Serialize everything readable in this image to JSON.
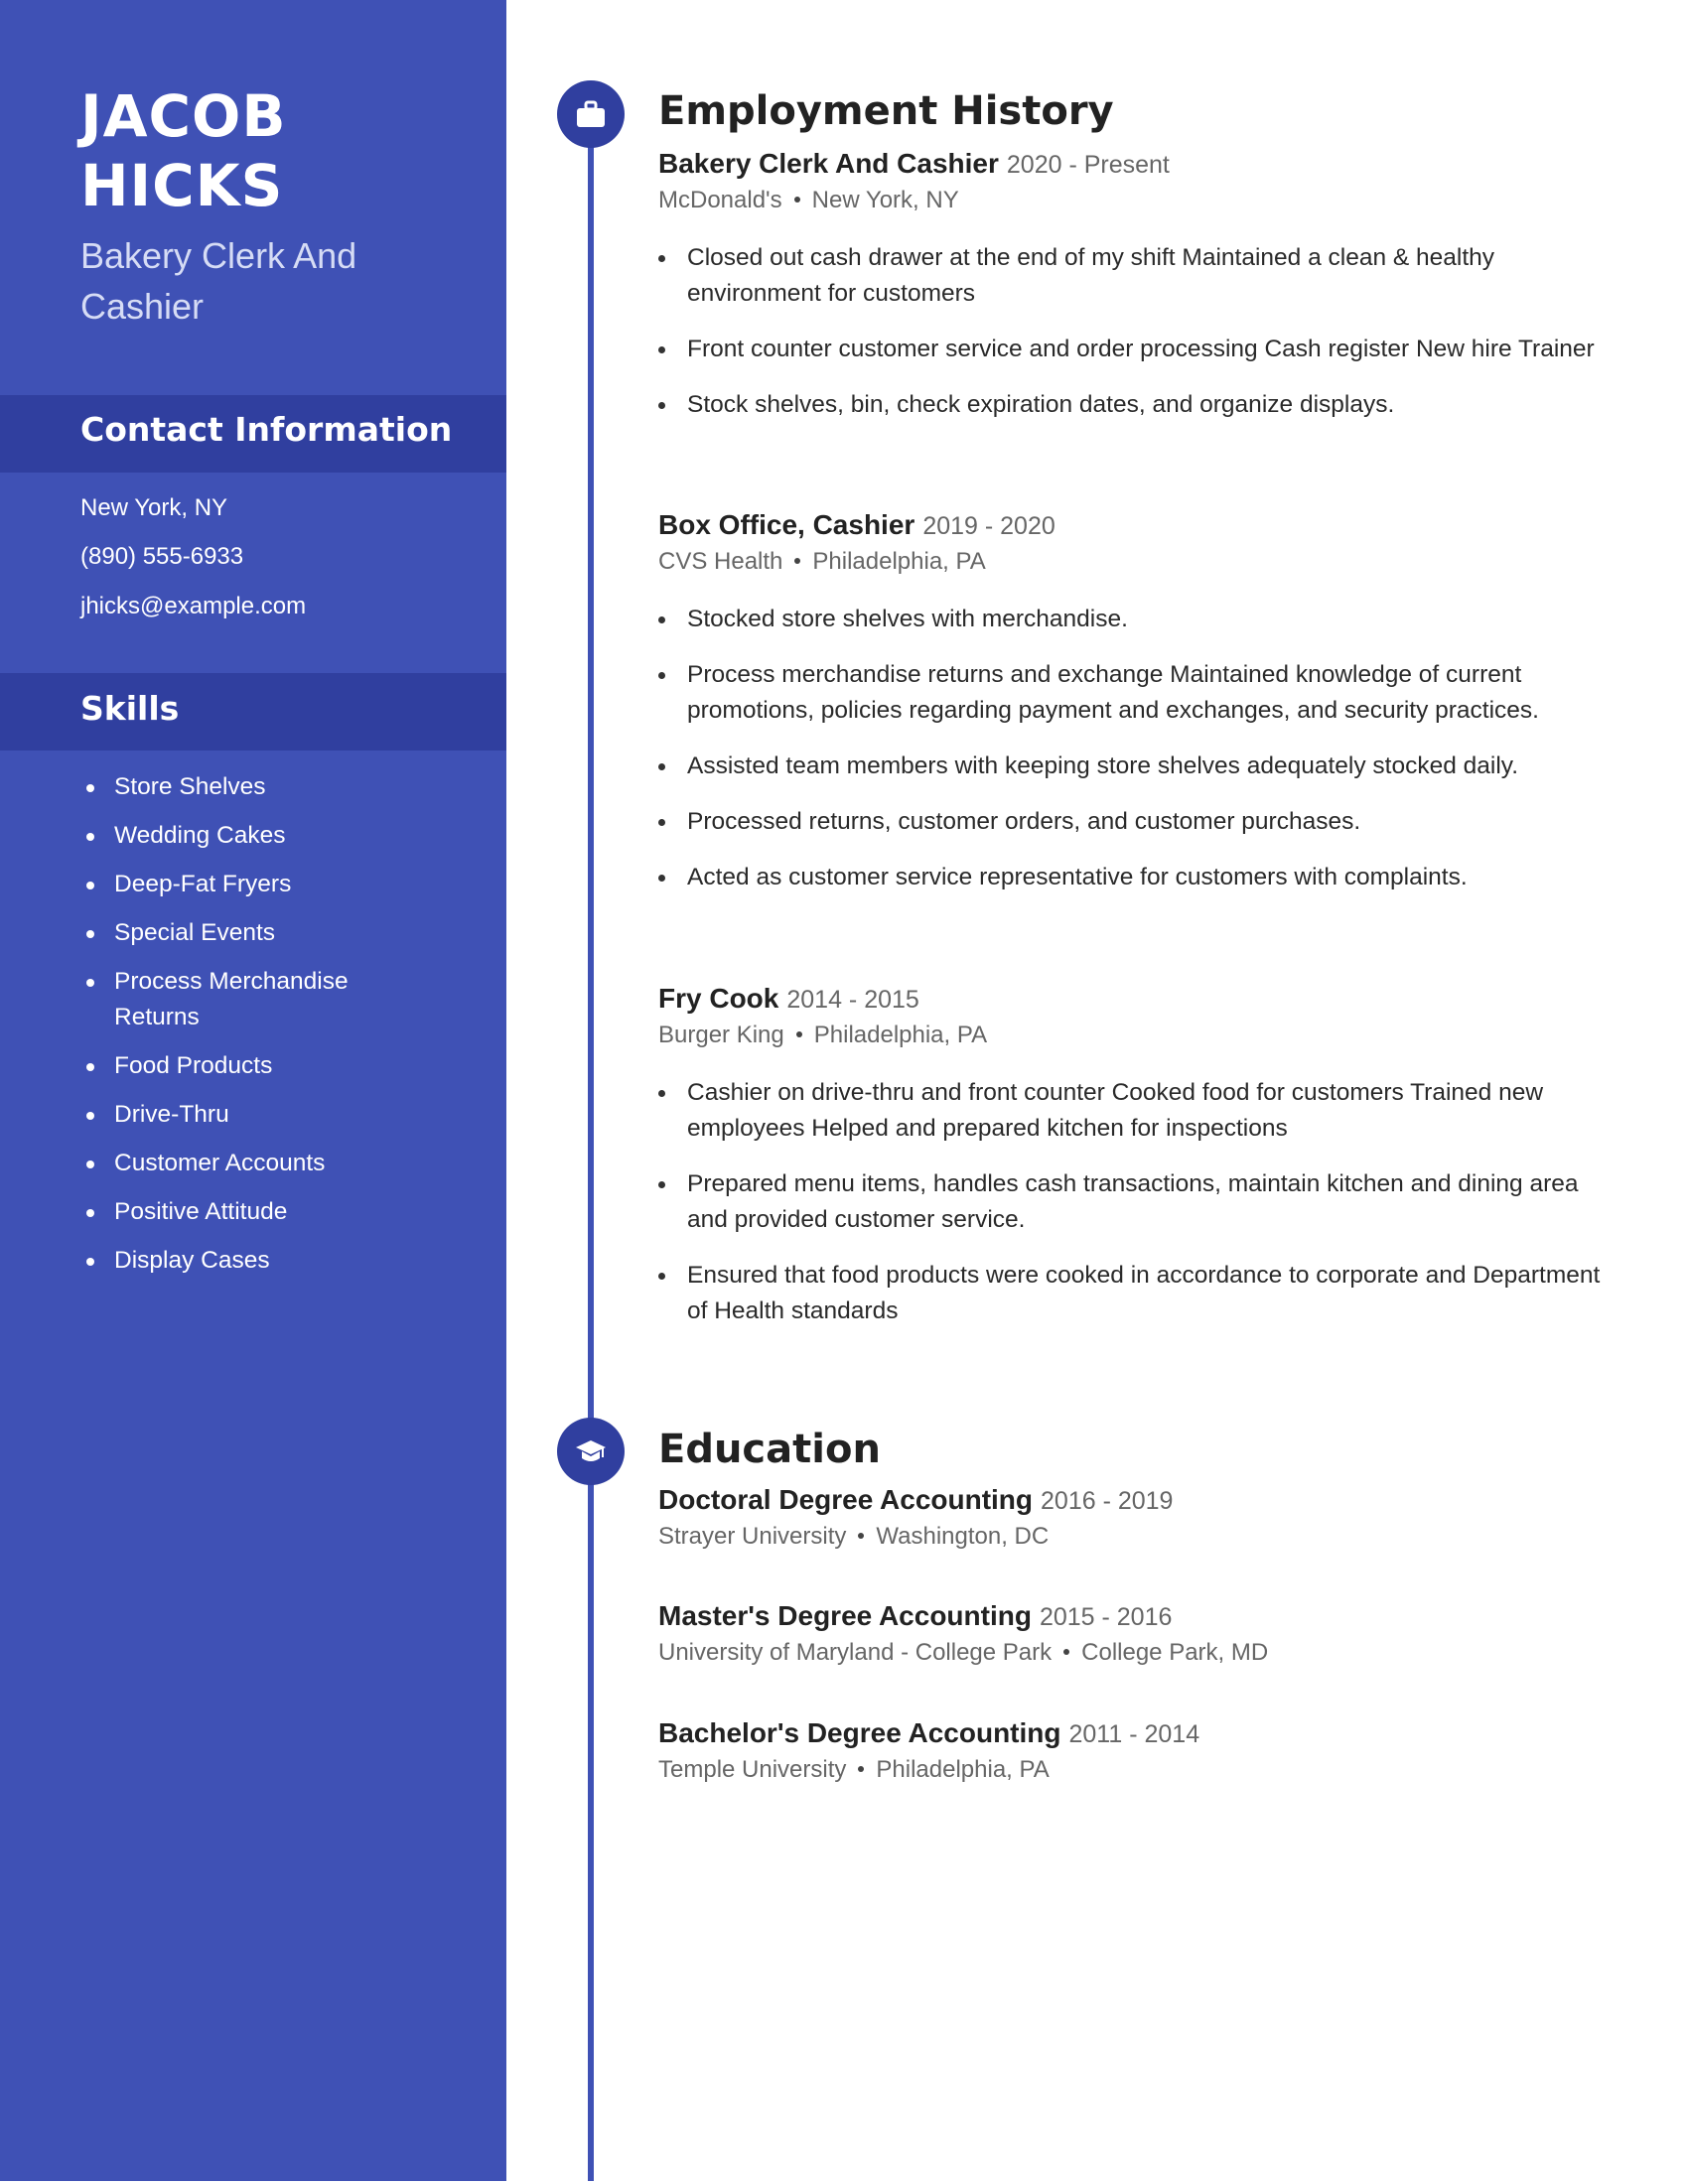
{
  "profile": {
    "first_name": "JACOB",
    "last_name": "HICKS",
    "title": "Bakery Clerk And Cashier"
  },
  "contact": {
    "heading": "Contact Information",
    "location": "New York, NY",
    "phone": "(890) 555-6933",
    "email": "jhicks@example.com"
  },
  "skills": {
    "heading": "Skills",
    "items": [
      "Store Shelves",
      "Wedding Cakes",
      "Deep-Fat Fryers",
      "Special Events",
      "Process Merchandise Returns",
      "Food Products",
      "Drive-Thru",
      "Customer Accounts",
      "Positive Attitude",
      "Display Cases"
    ]
  },
  "employment": {
    "heading": "Employment History",
    "icon": "briefcase-icon",
    "jobs": [
      {
        "title": "Bakery Clerk And Cashier",
        "dates": "2020 - Present",
        "company": "McDonald's",
        "location": "New York, NY",
        "bullets": [
          "Closed out cash drawer at the end of my shift Maintained a clean & healthy environment for customers",
          "Front counter customer service and order processing Cash register New hire Trainer",
          "Stock shelves, bin, check expiration dates, and organize displays."
        ]
      },
      {
        "title": "Box Office, Cashier",
        "dates": "2019 - 2020",
        "company": "CVS Health",
        "location": "Philadelphia, PA",
        "bullets": [
          "Stocked store shelves with merchandise.",
          "Process merchandise returns and exchange Maintained knowledge of current promotions, policies regarding payment and exchanges, and security practices.",
          "Assisted team members with keeping store shelves adequately stocked daily.",
          "Processed returns, customer orders, and customer purchases.",
          "Acted as customer service representative for customers with complaints."
        ]
      },
      {
        "title": "Fry Cook",
        "dates": "2014 - 2015",
        "company": "Burger King",
        "location": "Philadelphia, PA",
        "bullets": [
          "Cashier on drive-thru and front counter Cooked food for customers Trained new employees Helped and prepared kitchen for inspections",
          "Prepared menu items, handles cash transactions, maintain kitchen and dining area and provided customer service.",
          "Ensured that food products were cooked in accordance to corporate and Department of Health standards"
        ]
      }
    ]
  },
  "education": {
    "heading": "Education",
    "icon": "graduation-cap-icon",
    "entries": [
      {
        "degree": "Doctoral Degree Accounting",
        "dates": "2016 - 2019",
        "school": "Strayer University",
        "location": "Washington, DC"
      },
      {
        "degree": "Master's Degree Accounting",
        "dates": "2015 - 2016",
        "school": "University of Maryland - College Park",
        "location": "College Park, MD"
      },
      {
        "degree": "Bachelor's Degree Accounting",
        "dates": "2011 - 2014",
        "school": "Temple University",
        "location": "Philadelphia, PA"
      }
    ]
  },
  "colors": {
    "sidebar": "#3f51b5",
    "band": "#303f9f",
    "accent": "#3f51b5",
    "heading_text": "#222222",
    "muted_text": "#666666"
  }
}
